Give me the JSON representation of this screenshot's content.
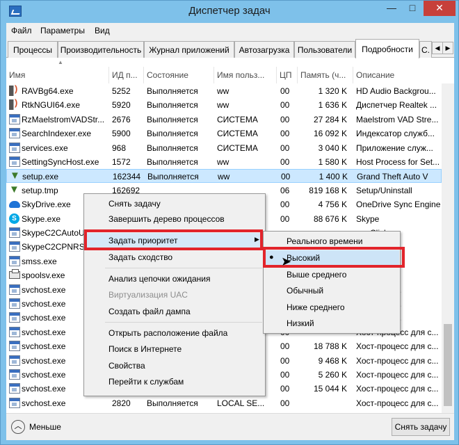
{
  "window": {
    "title": "Диспетчер задач",
    "controls": {
      "minimize": "—",
      "maximize": "□",
      "close": "✕"
    }
  },
  "menu": [
    "Файл",
    "Параметры",
    "Вид"
  ],
  "tabs": [
    {
      "label": "Процессы"
    },
    {
      "label": "Производительность"
    },
    {
      "label": "Журнал приложений"
    },
    {
      "label": "Автозагрузка"
    },
    {
      "label": "Пользователи"
    },
    {
      "label": "Подробности",
      "active": true
    },
    {
      "label": "С."
    }
  ],
  "tab_scroll": {
    "left": "◀",
    "right": "▶"
  },
  "columns": {
    "name": "Имя",
    "pid": "ИД п...",
    "state": "Состояние",
    "user": "Имя польз...",
    "cpu": "ЦП",
    "memory": "Память (ч...",
    "description": "Описание"
  },
  "sort_indicator": "▲",
  "rows": [
    {
      "icon": "speaker-icon",
      "name": "RAVBg64.exe",
      "pid": "5252",
      "state": "Выполняется",
      "user": "ww",
      "cpu": "00",
      "memory": "1 320 K",
      "description": "HD Audio Backgrou..."
    },
    {
      "icon": "speaker-icon",
      "name": "RtkNGUI64.exe",
      "pid": "5920",
      "state": "Выполняется",
      "user": "ww",
      "cpu": "00",
      "memory": "1 636 K",
      "description": "Диспетчер Realtek ..."
    },
    {
      "icon": "exe-icon",
      "name": "RzMaelstromVADStr...",
      "pid": "2676",
      "state": "Выполняется",
      "user": "СИСТЕМА",
      "cpu": "00",
      "memory": "27 284 K",
      "description": "Maelstrom VAD Stre..."
    },
    {
      "icon": "exe-icon",
      "name": "SearchIndexer.exe",
      "pid": "5900",
      "state": "Выполняется",
      "user": "СИСТЕМА",
      "cpu": "00",
      "memory": "16 092 K",
      "description": "Индексатор служб..."
    },
    {
      "icon": "exe-icon",
      "name": "services.exe",
      "pid": "968",
      "state": "Выполняется",
      "user": "СИСТЕМА",
      "cpu": "00",
      "memory": "3 040 K",
      "description": "Приложение служ..."
    },
    {
      "icon": "exe-icon",
      "name": "SettingSyncHost.exe",
      "pid": "1572",
      "state": "Выполняется",
      "user": "ww",
      "cpu": "00",
      "memory": "1 580 K",
      "description": "Host Process for Set..."
    },
    {
      "icon": "setup-icon",
      "name": "setup.exe",
      "pid": "162344",
      "state": "Выполняется",
      "user": "ww",
      "cpu": "00",
      "memory": "1 400 K",
      "description": "Grand Theft Auto V",
      "selected": true
    },
    {
      "icon": "setup-icon",
      "name": "setup.tmp",
      "pid": "162692",
      "state": "",
      "user": "",
      "cpu": "06",
      "memory": "819 168 K",
      "description": "Setup/Uninstall"
    },
    {
      "icon": "cloud-icon",
      "name": "SkyDrive.exe",
      "pid": "",
      "state": "",
      "user": "",
      "cpu": "00",
      "memory": "4 756 K",
      "description": "OneDrive Sync Engine"
    },
    {
      "icon": "skype-icon",
      "name": "Skype.exe",
      "pid": "",
      "state": "",
      "user": "",
      "cpu": "00",
      "memory": "88 676 K",
      "description": "Skype"
    },
    {
      "icon": "exe-icon",
      "name": "SkypeC2CAutoUp...",
      "pid": "",
      "state": "",
      "user": "",
      "cpu": "",
      "memory": "",
      "description": "...e Click..."
    },
    {
      "icon": "exe-icon",
      "name": "SkypeC2CPNRSv...",
      "pid": "",
      "state": "",
      "user": "",
      "cpu": "",
      "memory": "",
      "description": "...Rec..."
    },
    {
      "icon": "exe-icon",
      "name": "smss.exe",
      "pid": "",
      "state": "",
      "user": "",
      "cpu": "",
      "memory": "",
      "description": "...еанса"
    },
    {
      "icon": "printer-icon",
      "name": "spoolsv.exe",
      "pid": "",
      "state": "",
      "user": "",
      "cpu": "",
      "memory": "",
      "description": "...очеред..."
    },
    {
      "icon": "exe-icon",
      "name": "svchost.exe",
      "pid": "",
      "state": "",
      "user": "",
      "cpu": "",
      "memory": "",
      "description": "...сс для с..."
    },
    {
      "icon": "exe-icon",
      "name": "svchost.exe",
      "pid": "",
      "state": "",
      "user": "",
      "cpu": "",
      "memory": "",
      "description": "...сс для с..."
    },
    {
      "icon": "exe-icon",
      "name": "svchost.exe",
      "pid": "",
      "state": "",
      "user": "",
      "cpu": "",
      "memory": "",
      "description": "...сс для с..."
    },
    {
      "icon": "exe-icon",
      "name": "svchost.exe",
      "pid": "",
      "state": "",
      "user": "",
      "cpu": "00",
      "memory": "",
      "description": "Хост-процесс для с..."
    },
    {
      "icon": "exe-icon",
      "name": "svchost.exe",
      "pid": "",
      "state": "",
      "user": "",
      "cpu": "00",
      "memory": "18 788 K",
      "description": "Хост-процесс для с..."
    },
    {
      "icon": "exe-icon",
      "name": "svchost.exe",
      "pid": "",
      "state": "",
      "user": "",
      "cpu": "00",
      "memory": "9 468 K",
      "description": "Хост-процесс для с..."
    },
    {
      "icon": "exe-icon",
      "name": "svchost.exe",
      "pid": "",
      "state": "",
      "user": "",
      "cpu": "00",
      "memory": "5 260 K",
      "description": "Хост-процесс для с..."
    },
    {
      "icon": "exe-icon",
      "name": "svchost.exe",
      "pid": "",
      "state": "",
      "user": "",
      "cpu": "00",
      "memory": "15 044 K",
      "description": "Хост-процесс для с..."
    },
    {
      "icon": "exe-icon",
      "name": "svchost.exe",
      "pid": "2820",
      "state": "Выполняется",
      "user": "LOCAL SE...",
      "cpu": "00",
      "memory": "",
      "description": "Хост-процесс для с..."
    }
  ],
  "context_menu": {
    "items": [
      {
        "label": "Снять задачу"
      },
      {
        "label": "Завершить дерево процессов"
      },
      {
        "label": "Задать приоритет",
        "submenu": true,
        "arrow": "▶"
      },
      {
        "label": "Задать сходство"
      },
      {
        "label": "Анализ цепочки ожидания"
      },
      {
        "label": "Виртуализация UAC",
        "disabled": true
      },
      {
        "label": "Создать файл дампа"
      },
      {
        "label": "Открыть расположение файла"
      },
      {
        "label": "Поиск в Интернете"
      },
      {
        "label": "Свойства"
      },
      {
        "label": "Перейти к службам"
      }
    ]
  },
  "priority_submenu": {
    "items": [
      "Реального времени",
      "Высокий",
      "Выше среднего",
      "Обычный",
      "Ниже среднего",
      "Низкий"
    ],
    "checked_index": 1,
    "bullet": "●"
  },
  "footer": {
    "less_icon": "︿",
    "less_label": "Меньше",
    "end_task_button": "Снять задачу"
  },
  "colors": {
    "highlight_border": "#e2242b",
    "selected_row": "#cce8ff",
    "window_frame": "#7ec1ea"
  }
}
